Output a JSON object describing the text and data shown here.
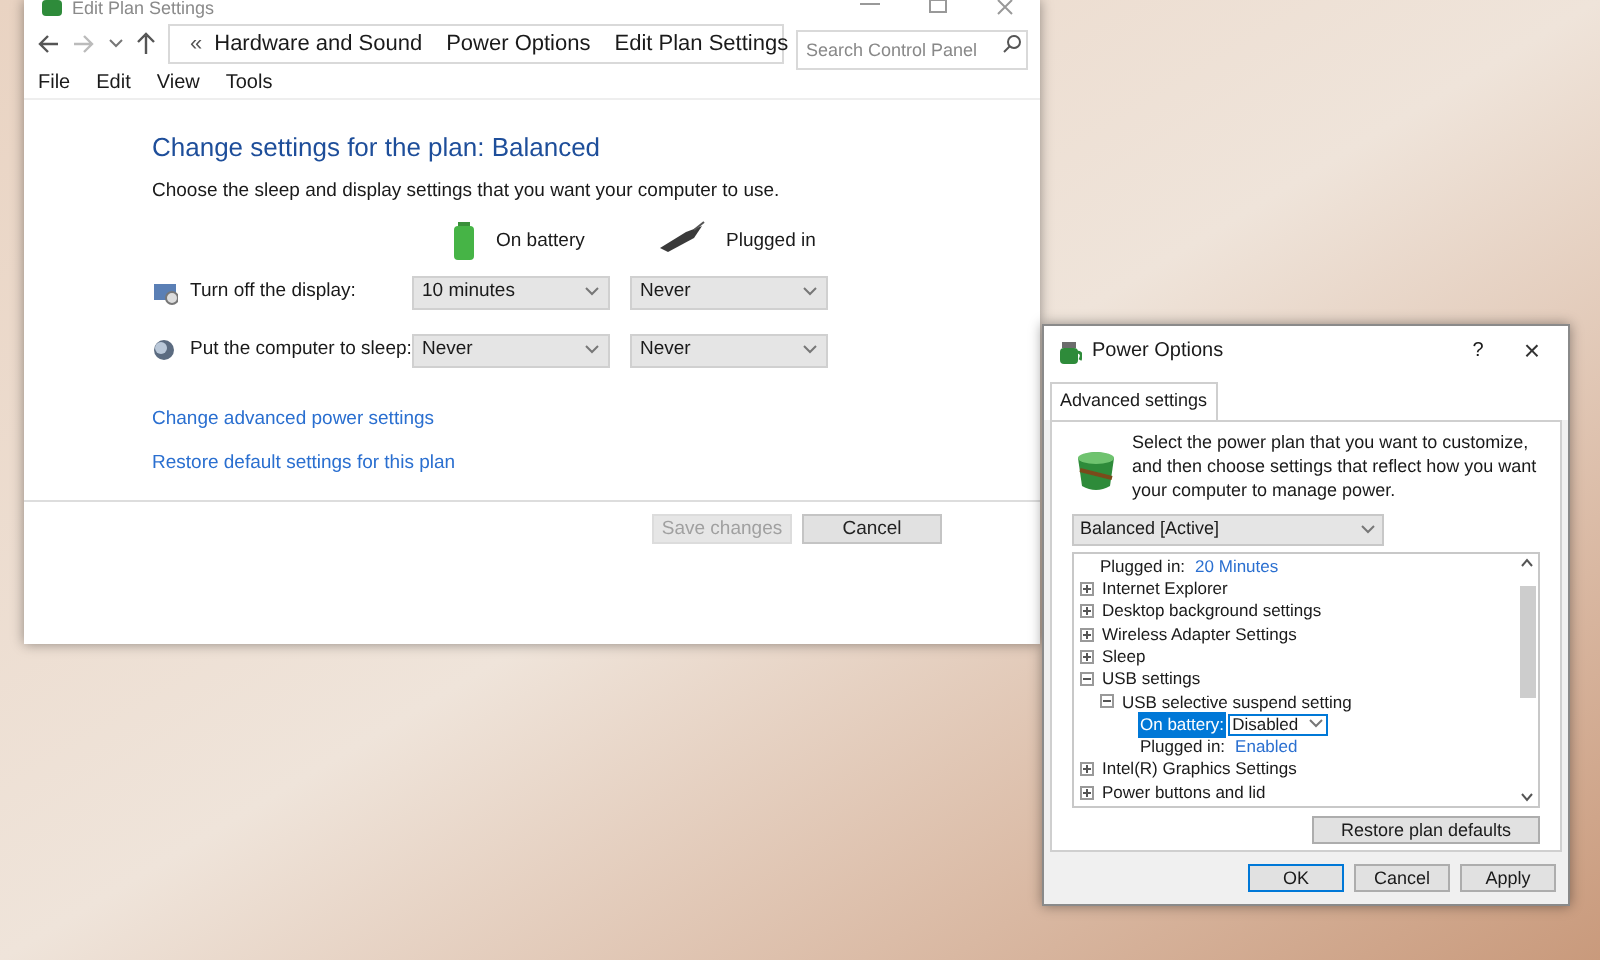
{
  "main_window": {
    "title": "Edit Plan Settings",
    "address_bar": {
      "overflow": "«",
      "crumbs": [
        "Hardware and Sound",
        "Power Options",
        "Edit Plan Settings"
      ],
      "search": {
        "placeholder": "Search Control Panel"
      }
    },
    "menu": [
      "File",
      "Edit",
      "View",
      "Tools"
    ],
    "heading": "Change settings for the plan: Balanced",
    "description": "Choose the sleep and display settings that you want your computer to use.",
    "columns": [
      {
        "kind": "battery",
        "label": "On battery"
      },
      {
        "kind": "plug",
        "label": "Plugged in"
      }
    ],
    "settings": [
      {
        "kind": "display",
        "label": "Turn off the display:",
        "values": [
          "10 minutes",
          "Never"
        ]
      },
      {
        "kind": "sleep",
        "label": "Put the computer to sleep:",
        "values": [
          "Never",
          "Never"
        ]
      }
    ],
    "links": [
      "Change advanced power settings",
      "Restore default settings for this plan"
    ],
    "buttons": [
      {
        "label": "Save changes",
        "disabled": true
      },
      {
        "label": "Cancel",
        "disabled": false
      }
    ]
  },
  "dialog": {
    "title": "Power Options",
    "help": "?",
    "close": "×",
    "tab": {
      "label": "Advanced settings",
      "selected": true
    },
    "intro": "Select the power plan that you want to customize, and then choose settings that reflect how you want your computer to manage power.",
    "plan": "Balanced [Active]",
    "tree": [
      {
        "kind": "setting",
        "label": "Plugged in:",
        "value": "20 Minutes",
        "selected": false
      },
      {
        "kind": "group",
        "label": "Internet Explorer",
        "expanded": false
      },
      {
        "kind": "group",
        "label": "Desktop background settings",
        "expanded": false
      },
      {
        "kind": "group",
        "label": "Wireless Adapter Settings",
        "expanded": false
      },
      {
        "kind": "group",
        "label": "Sleep",
        "expanded": false
      },
      {
        "kind": "group",
        "label": "USB settings",
        "expanded": true,
        "children": [
          {
            "kind": "group",
            "label": "USB selective suspend setting",
            "expanded": true,
            "children": [
              {
                "kind": "setting",
                "label": "On battery:",
                "value": "Disabled",
                "selected": true
              },
              {
                "kind": "setting",
                "label": "Plugged in:",
                "value": "Enabled",
                "selected": false
              }
            ]
          }
        ]
      },
      {
        "kind": "group",
        "label": "Intel(R) Graphics Settings",
        "expanded": false
      },
      {
        "kind": "group",
        "label": "Power buttons and lid",
        "expanded": false
      }
    ],
    "restore": "Restore plan defaults",
    "buttons": [
      {
        "label": "OK",
        "default": true
      },
      {
        "label": "Cancel",
        "default": false
      },
      {
        "label": "Apply",
        "default": false
      }
    ]
  }
}
